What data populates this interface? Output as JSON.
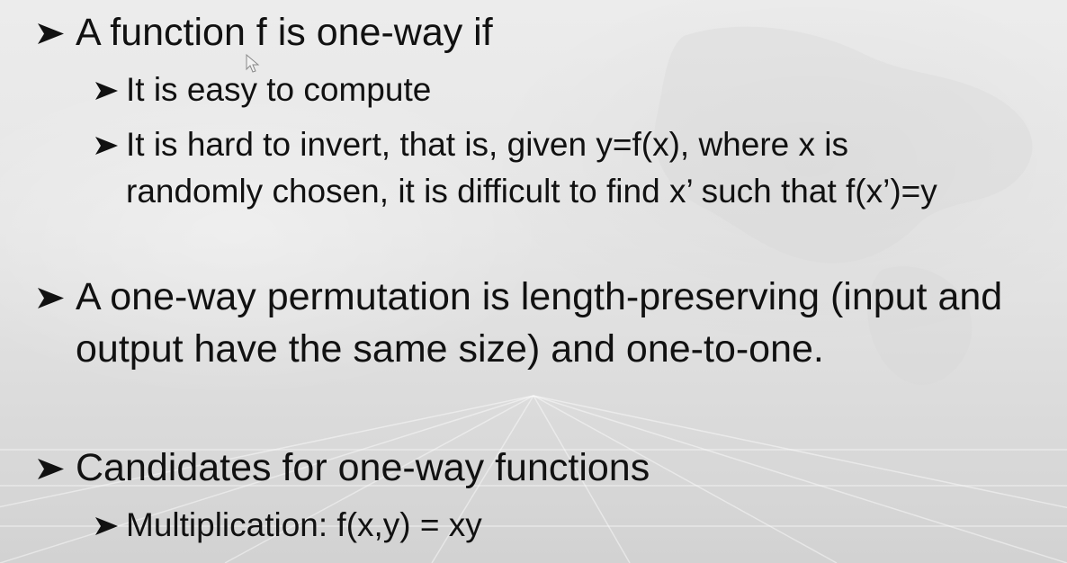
{
  "slide": {
    "bullets": [
      {
        "text": "A function f is one-way if",
        "sub": [
          {
            "text": "It is easy to compute"
          },
          {
            "text": "It is hard to invert, that is, given y=f(x), where x is randomly chosen, it is difficult to find x’ such that f(x’)=y"
          }
        ]
      },
      {
        "text": "A one-way permutation is length-preserving (input and output have the same size) and one-to-one.",
        "sub": []
      },
      {
        "text": "Candidates for one-way functions",
        "sub": [
          {
            "text": "Multiplication: f(x,y) = xy"
          }
        ]
      }
    ]
  },
  "icons": {
    "bullet": "arrowhead-bullet-icon",
    "cursor": "mouse-pointer-icon"
  },
  "colors": {
    "text": "#111111",
    "background": "#e6e6e6"
  }
}
